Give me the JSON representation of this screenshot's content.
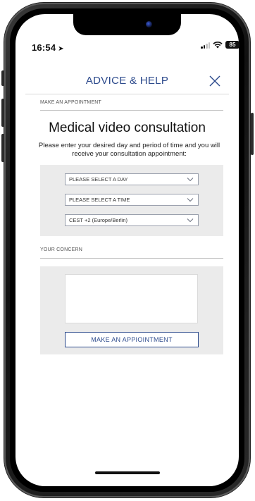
{
  "status_bar": {
    "time": "16:54",
    "battery": "85"
  },
  "header": {
    "title": "ADVICE & HELP"
  },
  "appointment_section": {
    "label": "MAKE AN APPOINTMENT",
    "title": "Medical video consultation",
    "intro": "Please enter your desired day and period of time and you will receive your consultation appointment:",
    "selects": [
      {
        "value": "PLEASE SELECT A DAY"
      },
      {
        "value": "PLEASE SELECT A TIME"
      },
      {
        "value": "CEST +2 (Europe/Berlin)"
      }
    ]
  },
  "concern_section": {
    "label": "YOUR CONCERN",
    "textarea_value": "",
    "submit_label": "MAKE AN APPIOINTMENT"
  },
  "colors": {
    "accent": "#2c4a8c",
    "panel_bg": "#ebebeb"
  },
  "icons": {
    "close": "close-icon",
    "chevron": "chevron-down-icon",
    "location": "location-arrow-icon",
    "signal": "cellular-signal-icon",
    "wifi": "wifi-icon",
    "battery": "battery-icon"
  }
}
